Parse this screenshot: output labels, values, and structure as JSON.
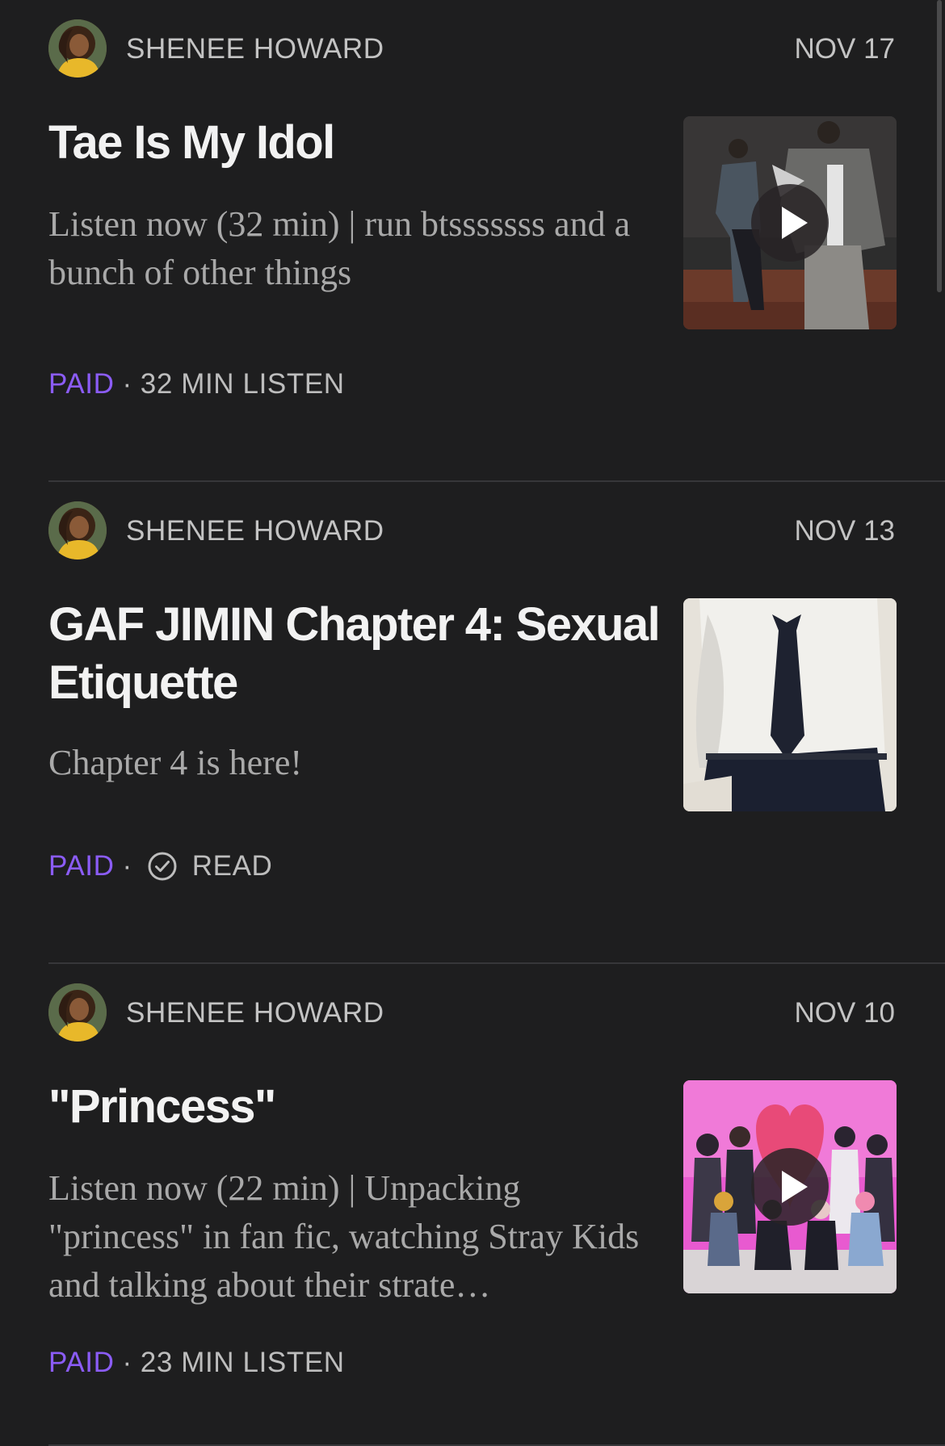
{
  "posts": [
    {
      "author": "SHENEE HOWARD",
      "date": "NOV 17",
      "title": "Tae Is My Idol",
      "subtitle": "Listen now (32 min) | run btsssssss and a bunch of other things",
      "badge": "PAID",
      "separator": "·",
      "meta": "32 MIN LISTEN",
      "has_play": true,
      "thumbnail": "dance-practice-thumbnail"
    },
    {
      "author": "SHENEE HOWARD",
      "date": "NOV 13",
      "title": "GAF JIMIN Chapter 4: Sexual Etiquette",
      "subtitle": "Chapter 4 is here!",
      "badge": "PAID",
      "separator": "·",
      "meta": "READ",
      "has_play": false,
      "thumbnail": "white-shirt-tie-thumbnail"
    },
    {
      "author": "SHENEE HOWARD",
      "date": "NOV 10",
      "title": "\"Princess\"",
      "subtitle": "Listen now (22 min) | Unpacking \"princess\" in fan fic, watching Stray Kids and talking about their strate…",
      "badge": "PAID",
      "separator": "·",
      "meta": "23 MIN LISTEN",
      "has_play": true,
      "thumbnail": "group-pink-heart-thumbnail"
    }
  ],
  "colors": {
    "background": "#1e1e1f",
    "accent_paid": "#8b5cf6",
    "meta_text": "#bdbdbd",
    "title_text": "#f2f2f2",
    "subtitle_text": "#a9a9a9"
  }
}
